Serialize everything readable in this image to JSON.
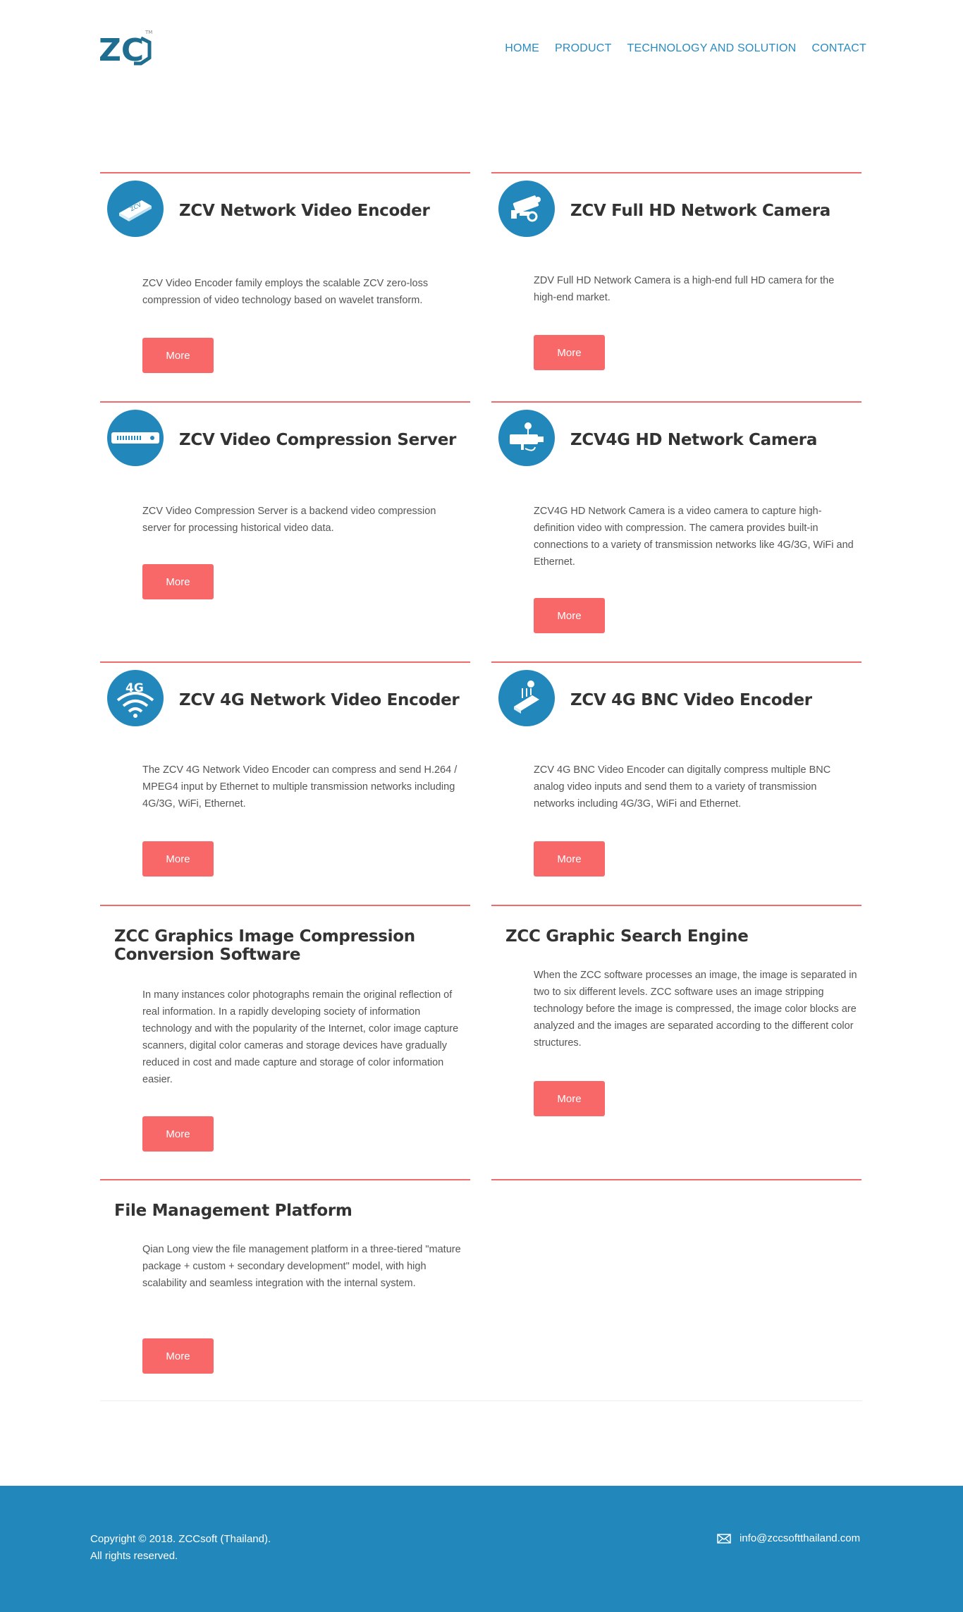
{
  "brand": {
    "logo_text": "ZC",
    "trademark": "TM"
  },
  "nav": {
    "items": [
      "HOME",
      "PRODUCT",
      "TECHNOLOGY AND SOLUTION",
      "CONTACT"
    ]
  },
  "products": [
    {
      "title": "ZCV Network Video Encoder",
      "icon": "encoder-icon",
      "description": "ZCV Video Encoder family employs the scalable ZCV zero-loss compression of video technology based on wavelet transform.",
      "button": "More"
    },
    {
      "title": "ZCV Full HD Network Camera",
      "icon": "camera-icon",
      "description": "ZDV Full HD Network Camera is a high-end full HD camera for the high-end market.",
      "button": "More"
    },
    {
      "title": "ZCV Video Compression Server",
      "icon": "server-icon",
      "description": "ZCV Video Compression Server is a backend video compression server for processing historical video data.",
      "button": "More"
    },
    {
      "title": "ZCV4G HD Network Camera",
      "icon": "4g-camera-icon",
      "description": "ZCV4G HD Network Camera is a video camera to capture high-definition video with compression. The camera provides built-in connections to a variety of transmission networks like 4G/3G, WiFi and Ethernet.",
      "button": "More"
    },
    {
      "title": "ZCV 4G Network Video Encoder",
      "icon": "4g-wifi-icon",
      "icon_text": "4G",
      "description": "The ZCV 4G Network Video Encoder can compress and send H.264 / MPEG4 input by Ethernet to multiple transmission networks including 4G/3G, WiFi, Ethernet.",
      "button": "More"
    },
    {
      "title": "ZCV 4G BNC Video Encoder",
      "icon": "bnc-encoder-icon",
      "description": "ZCV 4G BNC Video Encoder can digitally compress multiple BNC analog video inputs and send them to a variety of transmission networks including 4G/3G, WiFi and Ethernet.",
      "button": "More"
    },
    {
      "title": "ZCC Graphics Image Compression Conversion Software",
      "description": "In many instances color photographs remain the original reflection of real information. In a rapidly developing society of information technology and with the popularity of the Internet, color image capture scanners, digital color cameras and storage devices have gradually reduced in cost and made capture and storage of color information easier.",
      "button": "More"
    },
    {
      "title": "ZCC Graphic Search Engine",
      "description": "When the ZCC software processes an image, the image is separated in two to six different levels. ZCC software uses an image stripping technology before the image is compressed, the image color blocks are analyzed and the images are separated according to the different color structures.",
      "button": "More"
    },
    {
      "title": "File Management Platform",
      "description": "Qian Long view the file management platform in a three-tiered \"mature package + custom + secondary development\" model, with high scalability and seamless integration with the internal system.",
      "button": "More"
    }
  ],
  "footer": {
    "copyright_line1": "Copyright © 2018. ZCCsoft (Thailand).",
    "copyright_line2": "All rights reserved.",
    "email": "info@zccsoftthailand.com"
  },
  "colors": {
    "accent": "#2287ba",
    "nav_link": "#2a8bbf",
    "button": "#f96868",
    "divider": "#f06b6b"
  }
}
